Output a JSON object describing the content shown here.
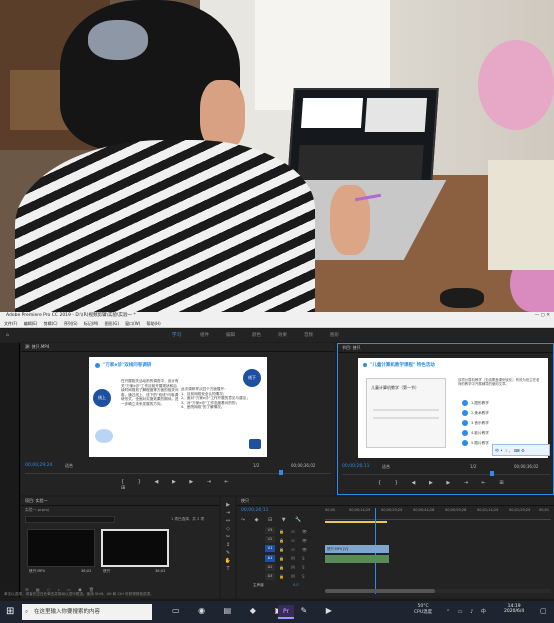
{
  "window": {
    "title": "Adobe Premiere Pro CC 2019 - D:\\(R)视频剪辑\\实验\\实验一 *",
    "menu": [
      "文件(F)",
      "编辑(E)",
      "剪辑(C)",
      "序列(S)",
      "标记(M)",
      "图形(G)",
      "窗口(W)",
      "帮助(H)"
    ]
  },
  "workspaces": [
    "学习",
    "组件",
    "编辑",
    "颜色",
    "效果",
    "音频",
    "图形"
  ],
  "source_monitor": {
    "tab": "源: 侠只.MP4",
    "slide_title": "\"万家e诊\"双线问卷调研",
    "badge_top": "线下",
    "badge_mid": "线上",
    "body_left": "在开展相关活动前的调查中，设计有关\"万家e诊\"工作目前开展现状和后续时间规划了解程度等方面的相关问卷，通过线上、线下的\"双线\"问卷调研形式，全面对实施效果的期待。进一步确立未来发展的方向。",
    "body_right": "此次调研样从四个方面展开：\n1、目前网络安全认知情况；\n2、面对\"万家e诊\"工作开展的意见与建议；\n3、对\"万家e诊\"工作态度看对的的；\n4、医院网络\"的了解情况。",
    "timecode": "00;00;29;24",
    "fit": "适合",
    "fraction": "1/2",
    "duration": "00;00;36;02"
  },
  "program_monitor": {
    "tab": "节目: 侠只",
    "slide_title": "\"儿童计算机教学课程\" 特色活动",
    "inner_title": "儿童计算机教学（第一节）",
    "desc": "该项计算机教学（无线覆盖课例优化）有效为班主任老师的教学中开展辅导的使用文章。",
    "items": [
      "1.图形教学",
      "2.美术教学",
      "3.音乐教学",
      "4.影片教学",
      "5.图片教学"
    ],
    "timecode": "00;00;26;11",
    "fit": "适合",
    "fraction": "1/2",
    "duration": "00;00;36;02",
    "ime": "中 • ☽ 、 ⌨ ⚙"
  },
  "project": {
    "tab": "项目: 实验一",
    "subtitle": "实验一.prproj",
    "selection": "1 项已选择，共 2 项",
    "thumbs": [
      {
        "name": "侠只.MP4",
        "time": "36;02"
      },
      {
        "name": "侠只",
        "time": "36;02"
      }
    ]
  },
  "timeline": {
    "tab": "侠只",
    "timecode": "00;00;26;11",
    "ruler": [
      "00;00",
      "00;00;14;29",
      "00;00;29;29",
      "00;00;44;28",
      "00;00;59;28",
      "00;01;14;29",
      "00;01;29;29",
      "00;01"
    ],
    "tracks": [
      "V3",
      "V2",
      "V1",
      "A1",
      "A2",
      "A3"
    ],
    "master": "主声道",
    "master_val": "0.0",
    "clip_label": "侠只.MP4 [V]"
  },
  "statusbar": "单击以选择，或者在空白处单击并拖动以进行框选。使用 Shift、Alt 和 Ctrl 可获得其他选项。",
  "taskbar": {
    "search_placeholder": "在这里输入你要搜索的内容",
    "weather": "50°C",
    "weather_label": "CPU温度",
    "time": "14:19",
    "date": "2020/6/4"
  },
  "colors": {
    "accent": "#2d8ceb",
    "clip": "#7fa6cf",
    "audio": "#5a8a5a",
    "playhead": "#2d8ceb"
  }
}
